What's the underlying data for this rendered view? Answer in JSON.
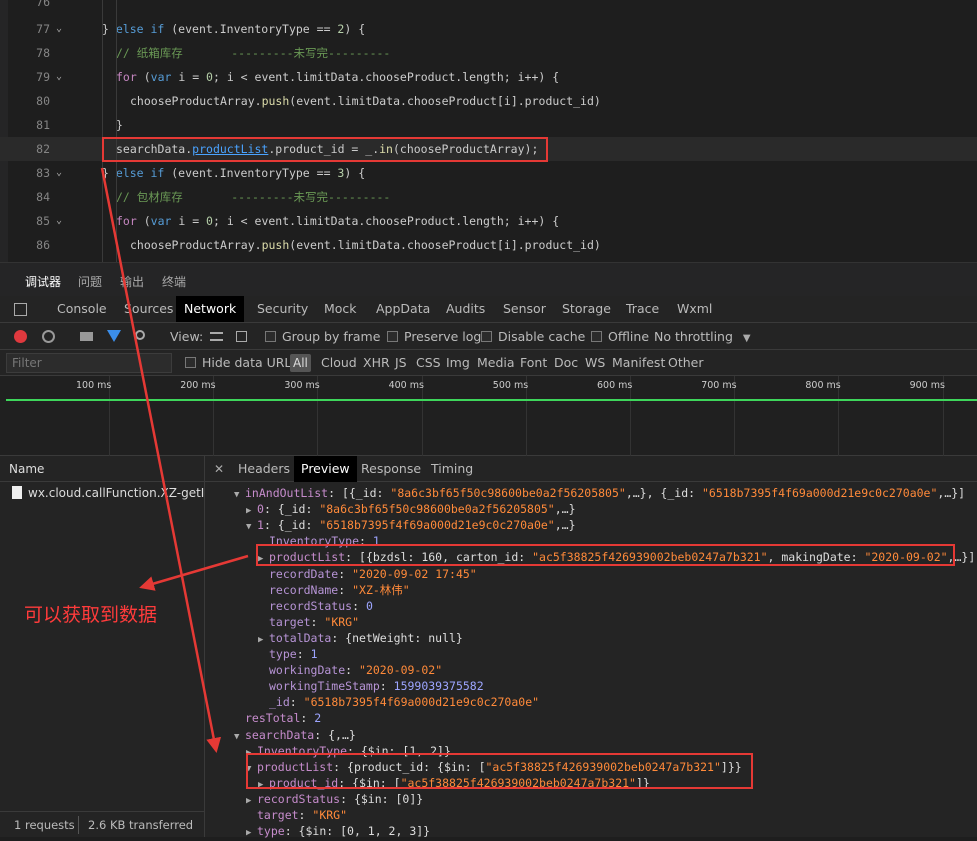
{
  "editor": {
    "lines": [
      {
        "num": "76",
        "parts": []
      },
      {
        "num": "77",
        "fold": true,
        "parts": [
          [
            "p",
            "} "
          ],
          [
            "kw",
            "else if"
          ],
          [
            "p",
            " (event.InventoryType == "
          ],
          [
            "num",
            "2"
          ],
          [
            "p",
            ") {"
          ]
        ]
      },
      {
        "num": "78",
        "parts": [
          [
            "cmt",
            "// 纸箱库存       ---------未写完---------"
          ]
        ]
      },
      {
        "num": "79",
        "fold": true,
        "parts": [
          [
            "kw2",
            "for"
          ],
          [
            "p",
            " ("
          ],
          [
            "kw",
            "var"
          ],
          [
            "p",
            " i = "
          ],
          [
            "num",
            "0"
          ],
          [
            "p",
            "; i < event.limitData.chooseProduct.length; i++) {"
          ]
        ]
      },
      {
        "num": "80",
        "parts": [
          [
            "p",
            "chooseProductArray."
          ],
          [
            "fn",
            "push"
          ],
          [
            "p",
            "(event.limitData.chooseProduct[i].product_id)"
          ]
        ]
      },
      {
        "num": "81",
        "parts": [
          [
            "p",
            "}"
          ]
        ]
      },
      {
        "num": "82",
        "parts": [
          [
            "p",
            "searchData."
          ],
          [
            "link",
            "productList"
          ],
          [
            "p",
            ".product_id = _."
          ],
          [
            "fn",
            "in"
          ],
          [
            "p",
            "(chooseProductArray);"
          ]
        ]
      },
      {
        "num": "83",
        "fold": true,
        "parts": [
          [
            "p",
            "} "
          ],
          [
            "kw",
            "else if"
          ],
          [
            "p",
            " (event.InventoryType == "
          ],
          [
            "num",
            "3"
          ],
          [
            "p",
            ") {"
          ]
        ]
      },
      {
        "num": "84",
        "parts": [
          [
            "cmt",
            "// 包材库存       ---------未写完---------"
          ]
        ]
      },
      {
        "num": "85",
        "fold": true,
        "parts": [
          [
            "kw2",
            "for"
          ],
          [
            "p",
            " ("
          ],
          [
            "kw",
            "var"
          ],
          [
            "p",
            " i = "
          ],
          [
            "num",
            "0"
          ],
          [
            "p",
            "; i < event.limitData.chooseProduct.length; i++) {"
          ]
        ]
      },
      {
        "num": "86",
        "parts": [
          [
            "p",
            "chooseProductArray."
          ],
          [
            "fn",
            "push"
          ],
          [
            "p",
            "(event.limitData.chooseProduct[i].product_id)"
          ]
        ]
      }
    ]
  },
  "devtools": {
    "top_tabs": [
      "调试器",
      "问题",
      "输出",
      "终端"
    ],
    "panel_tabs": [
      "Console",
      "Sources",
      "Network",
      "Security",
      "Mock",
      "AppData",
      "Audits",
      "Sensor",
      "Storage",
      "Trace",
      "Wxml"
    ],
    "toolbar": {
      "view_label": "View:",
      "group_by_frame": "Group by frame",
      "preserve_log": "Preserve log",
      "disable_cache": "Disable cache",
      "offline": "Offline",
      "throttling": "No throttling"
    },
    "filter": {
      "placeholder": "Filter",
      "hide_data_urls": "Hide data URLs",
      "types": [
        "All",
        "Cloud",
        "XHR",
        "JS",
        "CSS",
        "Img",
        "Media",
        "Font",
        "Doc",
        "WS",
        "Manifest",
        "Other"
      ]
    },
    "timeline_ticks": [
      "100 ms",
      "200 ms",
      "300 ms",
      "400 ms",
      "500 ms",
      "600 ms",
      "700 ms",
      "800 ms",
      "900 ms"
    ],
    "name_header": "Name",
    "request_name": "wx.cloud.callFunction.XZ-getIn...",
    "footer_requests": "1 requests",
    "footer_transferred": "2.6 KB transferred",
    "detail_tabs": [
      "Headers",
      "Preview",
      "Response",
      "Timing"
    ],
    "close_glyph": "✕"
  },
  "preview": {
    "lines": [
      {
        "indent": 0,
        "tri": "▼",
        "parts": [
          [
            "k",
            "inAndOutList"
          ],
          [
            "p",
            ": [{_id: "
          ],
          [
            "s",
            "\"8a6c3bf65f50c98600be0a2f56205805\""
          ],
          [
            "p",
            ",…}, {_id: "
          ],
          [
            "s",
            "\"6518b7395f4f69a000d21e9c0c270a0e\""
          ],
          [
            "p",
            ",…}]"
          ]
        ]
      },
      {
        "indent": 1,
        "tri": "▶",
        "parts": [
          [
            "k",
            "0"
          ],
          [
            "p",
            ": {_id: "
          ],
          [
            "s",
            "\"8a6c3bf65f50c98600be0a2f56205805\""
          ],
          [
            "p",
            ",…}"
          ]
        ]
      },
      {
        "indent": 1,
        "tri": "▼",
        "parts": [
          [
            "k",
            "1"
          ],
          [
            "p",
            ": {_id: "
          ],
          [
            "s",
            "\"6518b7395f4f69a000d21e9c0c270a0e\""
          ],
          [
            "p",
            ",…}"
          ]
        ]
      },
      {
        "indent": 2,
        "tri": "",
        "parts": [
          [
            "kp",
            "InventoryType"
          ],
          [
            "p",
            ": "
          ],
          [
            "n",
            "1"
          ]
        ]
      },
      {
        "indent": 2,
        "tri": "▶",
        "parts": [
          [
            "k",
            "productList"
          ],
          [
            "p",
            ": [{bzdsl: 160, carton_id: "
          ],
          [
            "s",
            "\"ac5f38825f426939002beb0247a7b321\""
          ],
          [
            "p",
            ", makingDate: "
          ],
          [
            "s",
            "\"2020-09-02\""
          ],
          [
            "p",
            ",…}]"
          ]
        ]
      },
      {
        "indent": 2,
        "tri": "",
        "parts": [
          [
            "kp",
            "recordDate"
          ],
          [
            "p",
            ": "
          ],
          [
            "s",
            "\"2020-09-02 17:45\""
          ]
        ]
      },
      {
        "indent": 2,
        "tri": "",
        "parts": [
          [
            "kp",
            "recordName"
          ],
          [
            "p",
            ": "
          ],
          [
            "s",
            "\"XZ-林伟\""
          ]
        ]
      },
      {
        "indent": 2,
        "tri": "",
        "parts": [
          [
            "kp",
            "recordStatus"
          ],
          [
            "p",
            ": "
          ],
          [
            "n",
            "0"
          ]
        ]
      },
      {
        "indent": 2,
        "tri": "",
        "parts": [
          [
            "kp",
            "target"
          ],
          [
            "p",
            ": "
          ],
          [
            "s",
            "\"KRG\""
          ]
        ]
      },
      {
        "indent": 2,
        "tri": "▶",
        "parts": [
          [
            "kp",
            "totalData"
          ],
          [
            "p",
            ": {netWeight: null}"
          ]
        ]
      },
      {
        "indent": 2,
        "tri": "",
        "parts": [
          [
            "kp",
            "type"
          ],
          [
            "p",
            ": "
          ],
          [
            "n",
            "1"
          ]
        ]
      },
      {
        "indent": 2,
        "tri": "",
        "parts": [
          [
            "kp",
            "workingDate"
          ],
          [
            "p",
            ": "
          ],
          [
            "s",
            "\"2020-09-02\""
          ]
        ]
      },
      {
        "indent": 2,
        "tri": "",
        "parts": [
          [
            "kp",
            "workingTimeStamp"
          ],
          [
            "p",
            ": "
          ],
          [
            "n",
            "1599039375582"
          ]
        ]
      },
      {
        "indent": 2,
        "tri": "",
        "parts": [
          [
            "kp",
            "_id"
          ],
          [
            "p",
            ": "
          ],
          [
            "s",
            "\"6518b7395f4f69a000d21e9c0c270a0e\""
          ]
        ]
      },
      {
        "indent": 0,
        "tri": "",
        "parts": [
          [
            "k",
            "resTotal"
          ],
          [
            "p",
            ": "
          ],
          [
            "n",
            "2"
          ]
        ]
      },
      {
        "indent": 0,
        "tri": "▼",
        "parts": [
          [
            "k",
            "searchData"
          ],
          [
            "p",
            ": {,…}"
          ]
        ]
      },
      {
        "indent": 1,
        "tri": "▶",
        "parts": [
          [
            "k",
            "InventoryType"
          ],
          [
            "p",
            ": {$in: [1, 2]}"
          ]
        ]
      },
      {
        "indent": 1,
        "tri": "▼",
        "parts": [
          [
            "k",
            "productList"
          ],
          [
            "p",
            ": {product_id: {$in: ["
          ],
          [
            "s",
            "\"ac5f38825f426939002beb0247a7b321\""
          ],
          [
            "p",
            "]}}"
          ]
        ]
      },
      {
        "indent": 2,
        "tri": "▶",
        "parts": [
          [
            "k",
            "product_id"
          ],
          [
            "p",
            ": {$in: ["
          ],
          [
            "s",
            "\"ac5f38825f426939002beb0247a7b321\""
          ],
          [
            "p",
            "]}"
          ]
        ]
      },
      {
        "indent": 1,
        "tri": "▶",
        "parts": [
          [
            "k",
            "recordStatus"
          ],
          [
            "p",
            ": {$in: [0]}"
          ]
        ]
      },
      {
        "indent": 1,
        "tri": "",
        "parts": [
          [
            "k",
            "target"
          ],
          [
            "p",
            ": "
          ],
          [
            "s",
            "\"KRG\""
          ]
        ]
      },
      {
        "indent": 1,
        "tri": "▶",
        "parts": [
          [
            "k",
            "type"
          ],
          [
            "p",
            ": {$in: [0, 1, 2, 3]}"
          ]
        ]
      }
    ]
  },
  "annotation": {
    "note": "可以获取到数据",
    "color": "#e53935"
  }
}
